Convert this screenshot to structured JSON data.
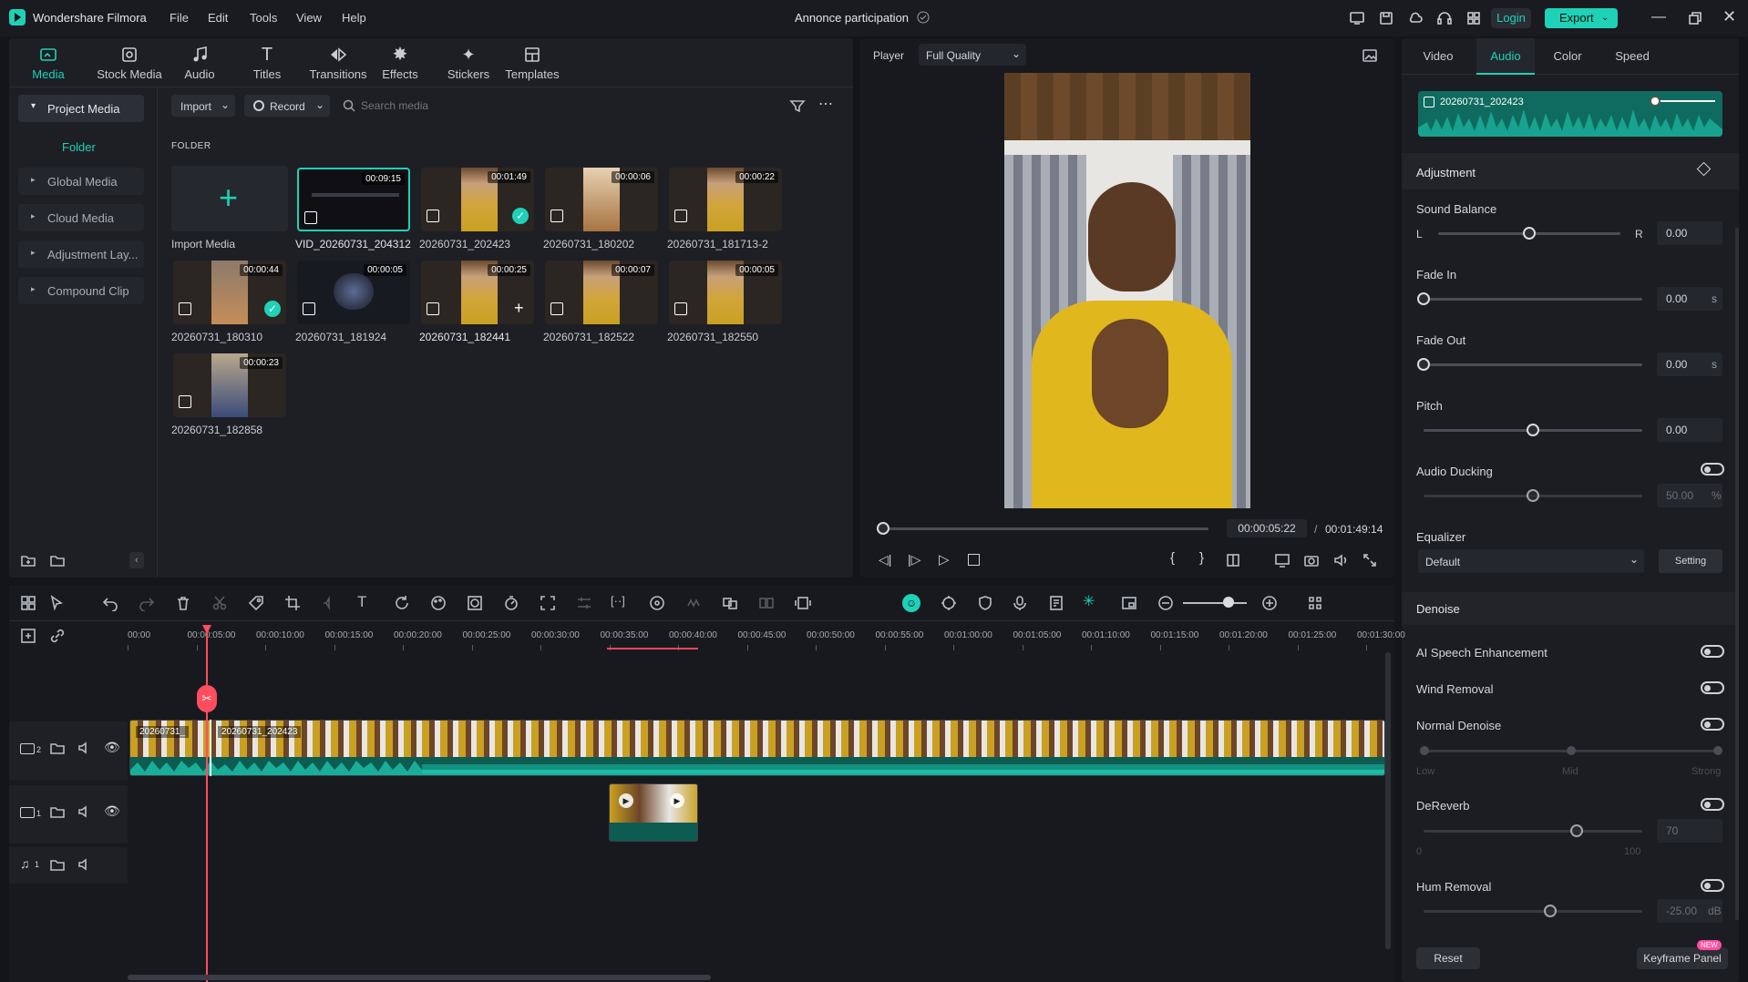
{
  "app": {
    "title": "Wondershare Filmora",
    "menu": [
      "File",
      "Edit",
      "Tools",
      "View",
      "Help"
    ],
    "project_name": "Annonce participation",
    "login": "Login",
    "export": "Export"
  },
  "toolbar_tabs": [
    {
      "label": "Media",
      "icon": "media-icon",
      "active": true
    },
    {
      "label": "Stock Media",
      "icon": "stock-media-icon"
    },
    {
      "label": "Audio",
      "icon": "music-note-icon"
    },
    {
      "label": "Titles",
      "icon": "titles-icon"
    },
    {
      "label": "Transitions",
      "icon": "transitions-icon"
    },
    {
      "label": "Effects",
      "icon": "effects-icon"
    },
    {
      "label": "Stickers",
      "icon": "stickers-icon"
    },
    {
      "label": "Templates",
      "icon": "templates-icon"
    }
  ],
  "sidebar": {
    "project_media": "Project Media",
    "folder": "Folder",
    "items": [
      "Global Media",
      "Cloud Media",
      "Adjustment Lay...",
      "Compound Clip"
    ]
  },
  "media_toolbar": {
    "import": "Import",
    "record": "Record",
    "search_placeholder": "Search media"
  },
  "folder_label": "FOLDER",
  "media": [
    {
      "name": "Import Media",
      "type": "import"
    },
    {
      "name": "VID_20260731_204312",
      "duration": "00:09:15",
      "selected": true
    },
    {
      "name": "20260731_202423",
      "duration": "00:01:49",
      "checked": true
    },
    {
      "name": "20260731_180202",
      "duration": "00:00:06"
    },
    {
      "name": "20260731_181713-2",
      "duration": "00:00:22"
    },
    {
      "name": "20260731_180310",
      "duration": "00:00:44",
      "checked": true
    },
    {
      "name": "20260731_181924",
      "duration": "00:00:05"
    },
    {
      "name": "20260731_182441",
      "duration": "00:00:25",
      "add": true
    },
    {
      "name": "20260731_182522",
      "duration": "00:00:07"
    },
    {
      "name": "20260731_182550",
      "duration": "00:00:05"
    },
    {
      "name": "20260731_182858",
      "duration": "00:00:23"
    }
  ],
  "player": {
    "label": "Player",
    "quality": "Full Quality",
    "current_time": "00:00:05:22",
    "separator": "/",
    "total_time": "00:01:49:14",
    "progress": 0.02
  },
  "right_panel": {
    "tabs": [
      "Video",
      "Audio",
      "Color",
      "Speed"
    ],
    "active_tab": "Audio",
    "clip_name": "20260731_202423",
    "adjustment": "Adjustment",
    "sound_balance": {
      "label": "Sound Balance",
      "left": "L",
      "right": "R",
      "value": "0.00",
      "level": 0.5
    },
    "fade_in": {
      "label": "Fade In",
      "value": "0.00",
      "unit": "s"
    },
    "fade_out": {
      "label": "Fade Out",
      "value": "0.00",
      "unit": "s"
    },
    "pitch": {
      "label": "Pitch",
      "value": "0.00",
      "level": 0.5
    },
    "audio_ducking": {
      "label": "Audio Ducking",
      "value": "50.00",
      "unit": "%",
      "level": 0.5
    },
    "equalizer": {
      "label": "Equalizer",
      "preset": "Default",
      "setting": "Setting"
    },
    "denoise": "Denoise",
    "ai_speech": "AI Speech Enhancement",
    "wind_removal": "Wind Removal",
    "normal_denoise": {
      "label": "Normal Denoise",
      "low": "Low",
      "mid": "Mid",
      "strong": "Strong"
    },
    "dereverb": {
      "label": "DeReverb",
      "value": "70",
      "min": "0",
      "max": "100",
      "level": 0.7
    },
    "hum_removal": {
      "label": "Hum Removal",
      "value": "-25.00",
      "unit": "dB",
      "level": 0.58
    },
    "reset": "Reset",
    "keyframe_panel": "Keyframe Panel",
    "new_badge": "NEW"
  },
  "timeline": {
    "ruler": [
      "00:00",
      "00:00:05:00",
      "00:00:10:00",
      "00:00:15:00",
      "00:00:20:00",
      "00:00:25:00",
      "00:00:30:00",
      "00:00:35:00",
      "00:00:40:00",
      "00:00:45:00",
      "00:00:50:00",
      "00:00:55:00",
      "00:01:00:00",
      "00:01:05:00",
      "00:01:10:00",
      "00:01:15:00",
      "00:01:20:00",
      "00:01:25:00",
      "00:01:30:00"
    ],
    "clips": [
      "20260731_",
      "20260731_202423"
    ],
    "tracks": [
      "2",
      "1",
      "1"
    ]
  },
  "colors": {
    "accent": "#1fd1b6",
    "playhead": "#ff4d5e",
    "export_bg": "#1fd1b6"
  }
}
